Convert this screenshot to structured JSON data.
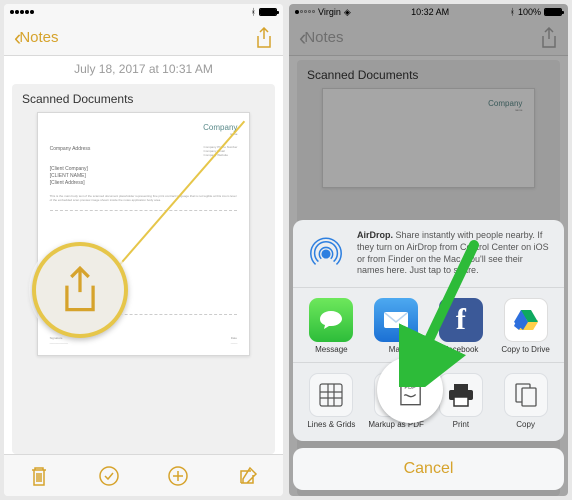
{
  "left": {
    "status": {
      "carrier": "",
      "time": "",
      "battery_percent": 100
    },
    "nav": {
      "back_label": "Notes"
    },
    "timestamp": "July 18, 2017 at 10:31 AM",
    "doc_title": "Scanned Documents",
    "doc": {
      "logo_name": "Company",
      "logo_sub": "name",
      "company_address": "Company Address",
      "client_company": "[Client Company]",
      "client_name": "[CLIENT NAME]",
      "client_address": "[Client Address]"
    }
  },
  "right": {
    "status": {
      "carrier": "Virgin",
      "time": "10:32 AM",
      "battery_percent": 100
    },
    "nav": {
      "back_label": "Notes"
    },
    "doc_title": "Scanned Documents",
    "doc": {
      "logo_name": "Company",
      "logo_sub": "name"
    },
    "airdrop": {
      "bold": "AirDrop.",
      "text": "Share instantly with people nearby. If they turn on AirDrop from Control Center on iOS or from Finder on the Mac, you'll see their names here. Just tap to share."
    },
    "apps": [
      {
        "label": "Message"
      },
      {
        "label": "Mail"
      },
      {
        "label": "Facebook"
      },
      {
        "label": "Copy to Drive"
      }
    ],
    "actions": [
      {
        "label": "Lines & Grids"
      },
      {
        "label": "Markup as PDF",
        "badge": "PDF"
      },
      {
        "label": "Print"
      },
      {
        "label": "Copy"
      }
    ],
    "cancel": "Cancel"
  }
}
